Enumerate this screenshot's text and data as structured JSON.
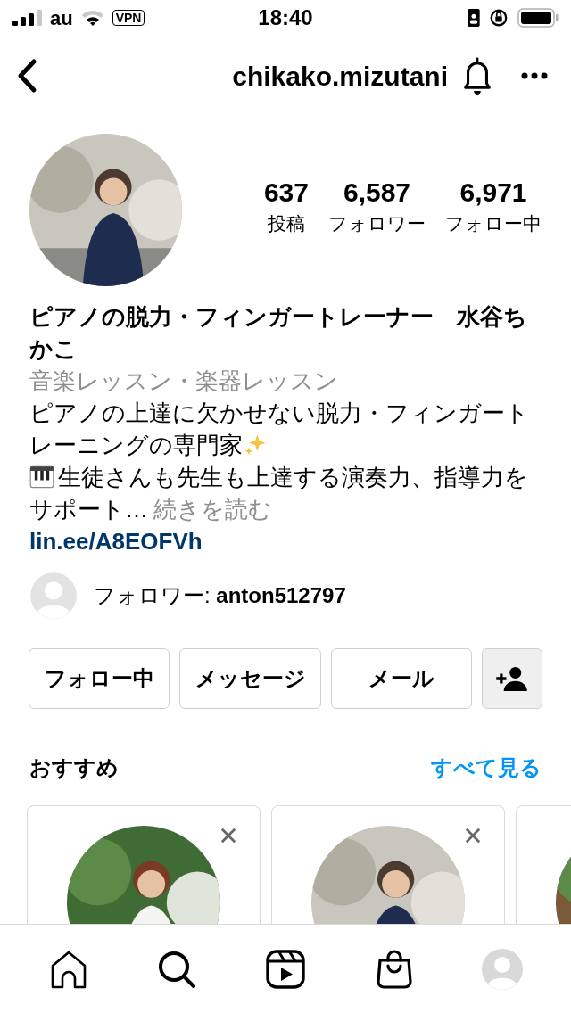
{
  "status_bar": {
    "carrier": "au",
    "vpn": "VPN",
    "time": "18:40"
  },
  "header": {
    "username": "chikako.mizutani"
  },
  "stats": [
    {
      "value": "637",
      "label": "投稿"
    },
    {
      "value": "6,587",
      "label": "フォロワー"
    },
    {
      "value": "6,971",
      "label": "フォロー中"
    }
  ],
  "bio": {
    "name": "ピアノの脱力・フィンガートレーナー　水谷ちかこ",
    "category": "音楽レッスン・楽器レッスン",
    "line_1a": "ピアノの上達に欠かせない脱力・フィンガート",
    "line_1b": "レーニングの専門家",
    "line_2a": "生徒さんも先生も上達する演奏力、指導力を",
    "line_2b": "サポート…",
    "more": "続きを読む",
    "link": "lin.ee/A8EOFVh"
  },
  "followed_by": {
    "prefix": "フォロワー: ",
    "user": "anton512797"
  },
  "actions": [
    {
      "kind": "text",
      "label": "フォロー中"
    },
    {
      "kind": "text",
      "label": "メッセージ"
    },
    {
      "kind": "text",
      "label": "メール"
    },
    {
      "kind": "add-person"
    }
  ],
  "suggestions": {
    "title": "おすすめ",
    "see_all": "すべて見る",
    "cards": [
      {
        "kind": "full"
      },
      {
        "kind": "full"
      },
      {
        "kind": "edge"
      }
    ]
  },
  "tab_bar": [
    {
      "kind": "home"
    },
    {
      "kind": "search"
    },
    {
      "kind": "reels"
    },
    {
      "kind": "shop"
    },
    {
      "kind": "profile"
    }
  ]
}
